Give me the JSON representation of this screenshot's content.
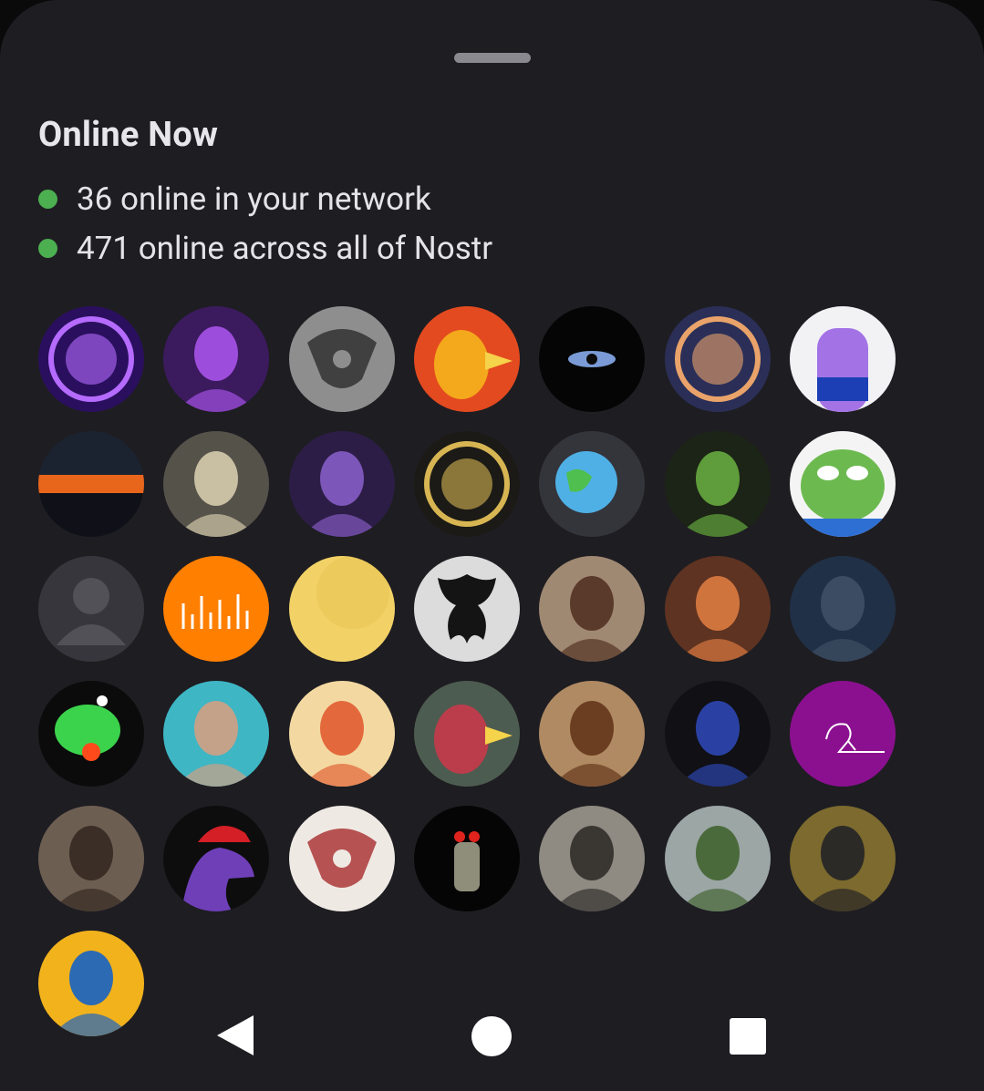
{
  "sheet": {
    "title": "Online Now",
    "stats": [
      {
        "label": "36 online in your network",
        "dot_color": "#4caf50"
      },
      {
        "label": "471 online across all of Nostr",
        "dot_color": "#4caf50"
      }
    ]
  },
  "avatars": [
    {
      "name": "avatar-purple-glow-character",
      "bg": "#2a0f5e",
      "fg": "#b56bff",
      "kind": "ring"
    },
    {
      "name": "avatar-purple-skull",
      "bg": "#3b1a5e",
      "fg": "#9d4ddb",
      "kind": "face"
    },
    {
      "name": "avatar-grey-pattern",
      "bg": "#8e8e8e",
      "fg": "#2d2d2d",
      "kind": "pattern"
    },
    {
      "name": "avatar-red-bird",
      "bg": "#e34a1f",
      "fg": "#f5b21b",
      "kind": "bird"
    },
    {
      "name": "avatar-eye",
      "bg": "#050505",
      "fg": "#7a9bd6",
      "kind": "eye"
    },
    {
      "name": "avatar-bitcoin-landscape",
      "bg": "#2b2f57",
      "fg": "#e9a36a",
      "kind": "ring"
    },
    {
      "name": "avatar-nostr-bottle",
      "bg": "#f2f2f5",
      "fg": "#a373e6",
      "kind": "bottle"
    },
    {
      "name": "avatar-sunset",
      "bg": "#101018",
      "fg": "#e8651c",
      "kind": "sunset"
    },
    {
      "name": "avatar-masked-man",
      "bg": "#55524a",
      "fg": "#c9bfa3",
      "kind": "face"
    },
    {
      "name": "avatar-hooded-man",
      "bg": "#2c1d46",
      "fg": "#7c56b8",
      "kind": "face"
    },
    {
      "name": "avatar-meme-bay",
      "bg": "#1b1a16",
      "fg": "#d7b553",
      "kind": "ring"
    },
    {
      "name": "avatar-globe-cartoon",
      "bg": "#34343b",
      "fg": "#4fb0e5",
      "kind": "globe"
    },
    {
      "name": "avatar-hooded-frog",
      "bg": "#1b2416",
      "fg": "#5f9c3b",
      "kind": "face"
    },
    {
      "name": "avatar-pepe-frog",
      "bg": "#f4f4f4",
      "fg": "#6cba4f",
      "kind": "frog"
    },
    {
      "name": "avatar-default-user",
      "bg": "#37363c",
      "fg": "#525158",
      "kind": "default"
    },
    {
      "name": "avatar-orange-waveform",
      "bg": "#ff7f00",
      "fg": "#ffffff",
      "kind": "wave"
    },
    {
      "name": "avatar-yellow-plain",
      "bg": "#f2d266",
      "fg": "#e6c14f",
      "kind": "plain"
    },
    {
      "name": "avatar-inkblot",
      "bg": "#dcdcdc",
      "fg": "#141414",
      "kind": "inkblot"
    },
    {
      "name": "avatar-smiling-woman",
      "bg": "#a08972",
      "fg": "#5a3a2a",
      "kind": "face"
    },
    {
      "name": "avatar-roaring-fox",
      "bg": "#5e3321",
      "fg": "#d0743e",
      "kind": "face"
    },
    {
      "name": "avatar-pilot-helmet",
      "bg": "#203046",
      "fg": "#3c4c62",
      "kind": "face"
    },
    {
      "name": "avatar-green-alien",
      "bg": "#0b0b0b",
      "fg": "#3bd34c",
      "kind": "alien"
    },
    {
      "name": "avatar-bald-bearded-man",
      "bg": "#3eb6c4",
      "fg": "#c4a28a",
      "kind": "face"
    },
    {
      "name": "avatar-viking-chainsaw",
      "bg": "#f3d9a1",
      "fg": "#e3693d",
      "kind": "face"
    },
    {
      "name": "avatar-red-parrot",
      "bg": "#4d5c50",
      "fg": "#c83a4a",
      "kind": "bird"
    },
    {
      "name": "avatar-bearded-man-illustration",
      "bg": "#b08a63",
      "fg": "#6b3e22",
      "kind": "face"
    },
    {
      "name": "avatar-man-in-suit",
      "bg": "#101015",
      "fg": "#2a41a3",
      "kind": "face"
    },
    {
      "name": "avatar-purple-sketch",
      "bg": "#8b1090",
      "fg": "#ffffff",
      "kind": "sketch"
    },
    {
      "name": "avatar-man-photo",
      "bg": "#6d5e52",
      "fg": "#3a2e26",
      "kind": "face"
    },
    {
      "name": "avatar-purple-duck-cap",
      "bg": "#0d0d0d",
      "fg": "#6f3fb8",
      "kind": "duck"
    },
    {
      "name": "avatar-red-woodcut-face",
      "bg": "#efe9e4",
      "fg": "#a82d2d",
      "kind": "pattern"
    },
    {
      "name": "avatar-red-eyed-robot",
      "bg": "#050505",
      "fg": "#e0231d",
      "kind": "robot"
    },
    {
      "name": "avatar-engraving-portrait",
      "bg": "#8f8a82",
      "fg": "#3a3733",
      "kind": "face"
    },
    {
      "name": "avatar-driving-photo",
      "bg": "#9ba6a5",
      "fg": "#4b6a3c",
      "kind": "face"
    },
    {
      "name": "avatar-painting-reader",
      "bg": "#7c6a2e",
      "fg": "#2c2a27",
      "kind": "face"
    },
    {
      "name": "avatar-speaker-photo",
      "bg": "#f2b21c",
      "fg": "#2c6ab3",
      "kind": "face"
    }
  ],
  "navbar": {
    "back_icon": "back-triangle-icon",
    "home_icon": "home-circle-icon",
    "recents_icon": "recents-square-icon",
    "color": "#ffffff"
  }
}
